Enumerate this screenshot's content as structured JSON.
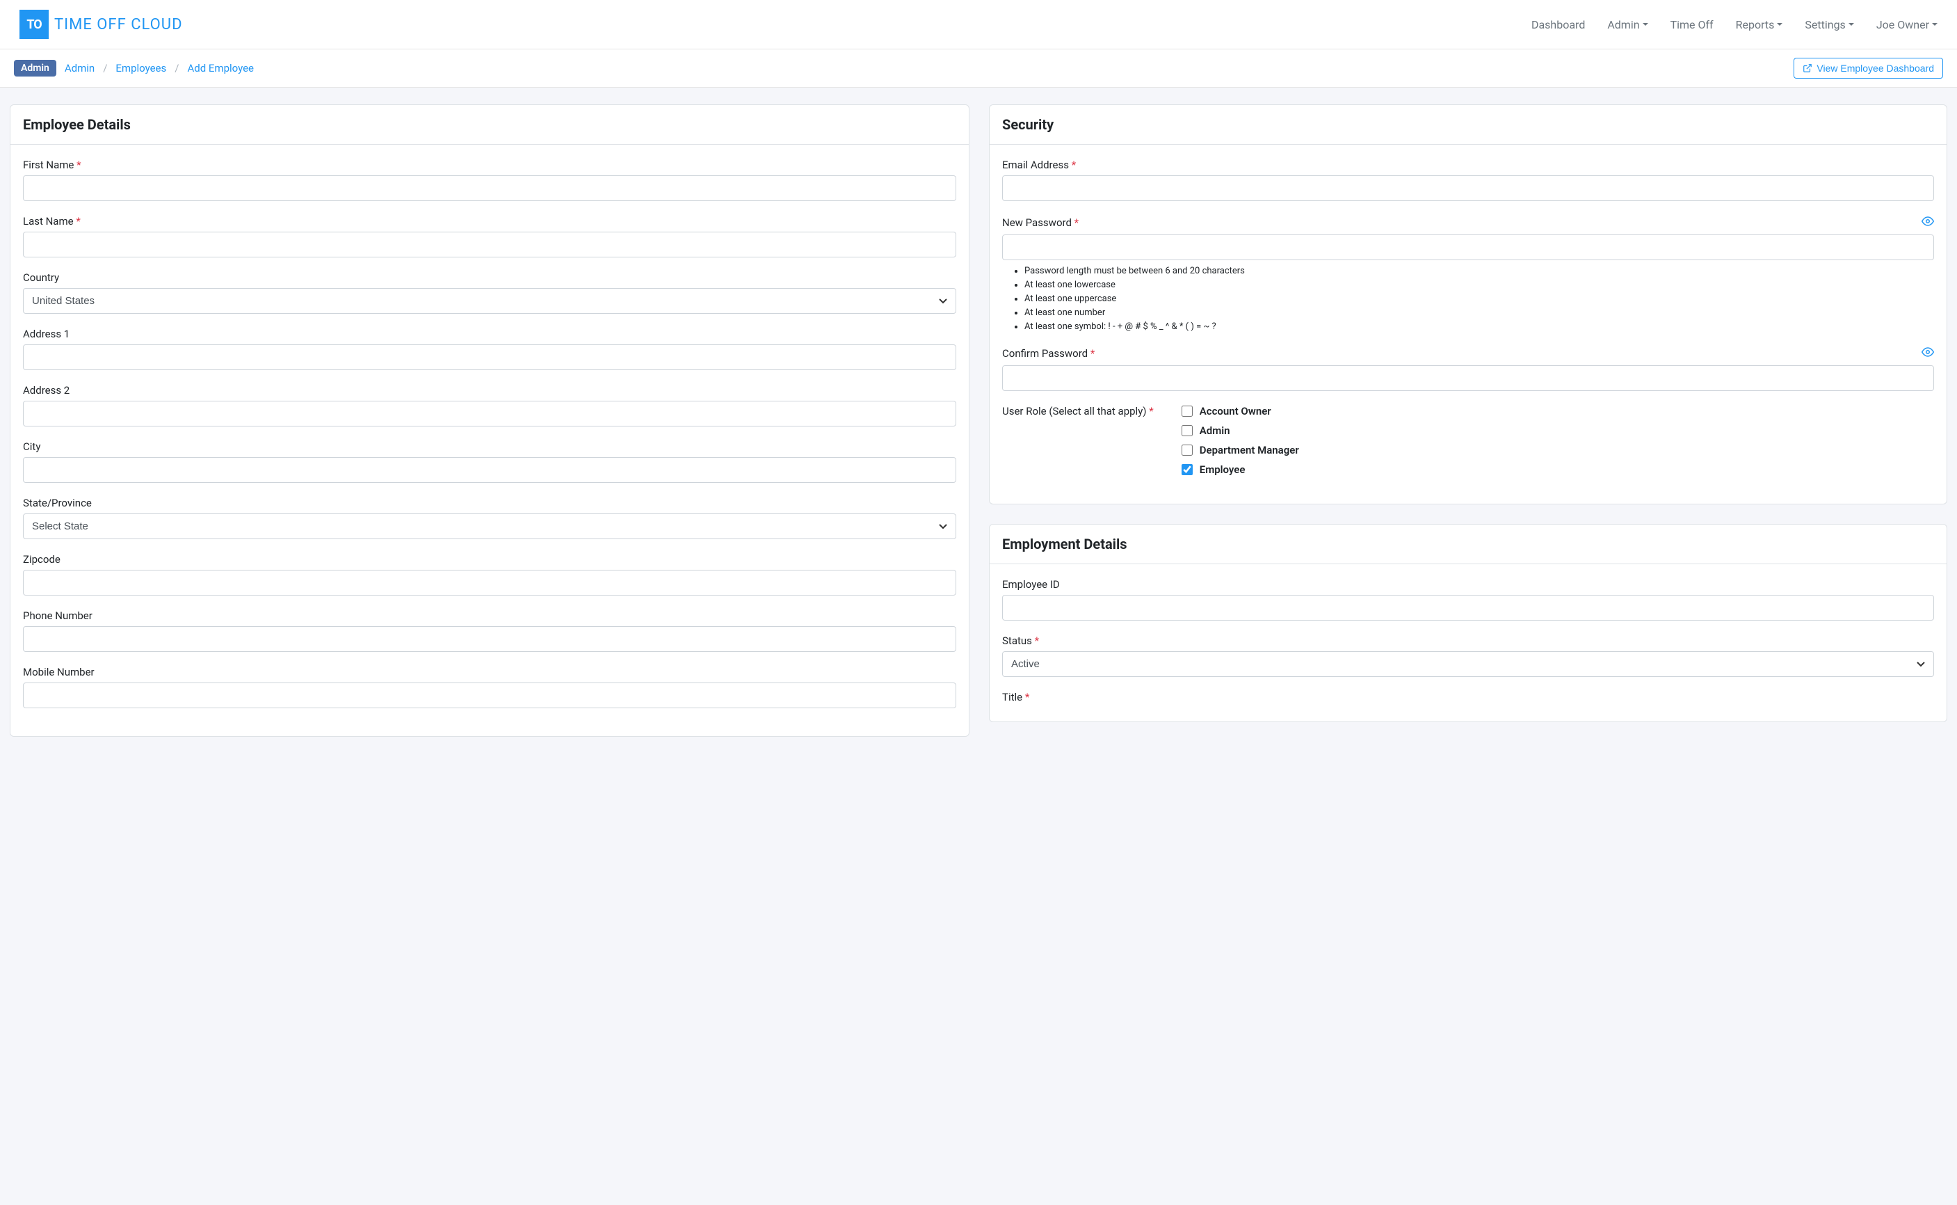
{
  "logo": {
    "box": "TO",
    "text": "TIME OFF CLOUD"
  },
  "nav": {
    "dashboard": "Dashboard",
    "admin": "Admin",
    "timeoff": "Time Off",
    "reports": "Reports",
    "settings": "Settings",
    "user": "Joe Owner"
  },
  "breadcrumb": {
    "badge": "Admin",
    "link1": "Admin",
    "link2": "Employees",
    "link3": "Add Employee"
  },
  "view_dashboard_btn": "View Employee Dashboard",
  "employee_details": {
    "title": "Employee Details",
    "first_name_label": "First Name",
    "last_name_label": "Last Name",
    "country_label": "Country",
    "country_value": "United States",
    "address1_label": "Address 1",
    "address2_label": "Address 2",
    "city_label": "City",
    "state_label": "State/Province",
    "state_value": "Select State",
    "zipcode_label": "Zipcode",
    "phone_label": "Phone Number",
    "mobile_label": "Mobile Number"
  },
  "security": {
    "title": "Security",
    "email_label": "Email Address",
    "new_password_label": "New Password",
    "confirm_password_label": "Confirm Password",
    "hints": [
      "Password length must be between 6 and 20 characters",
      "At least one lowercase",
      "At least one uppercase",
      "At least one number",
      "At least one symbol: ! - + @ # $ % _ ^ & * ( ) = ~ ?"
    ],
    "user_role_label": "User Role (Select all that apply)",
    "roles": {
      "owner": "Account Owner",
      "admin": "Admin",
      "dept_manager": "Department Manager",
      "employee": "Employee"
    }
  },
  "employment": {
    "title": "Employment Details",
    "employee_id_label": "Employee ID",
    "status_label": "Status",
    "status_value": "Active",
    "title_label": "Title"
  }
}
